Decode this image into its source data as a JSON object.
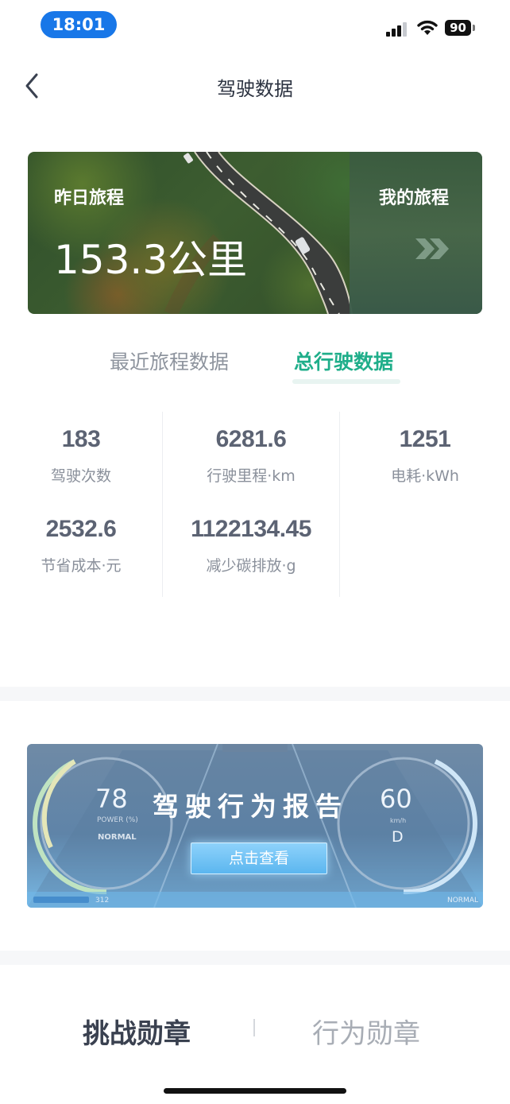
{
  "status_bar": {
    "time": "18:01",
    "battery": "90"
  },
  "nav": {
    "title": "驾驶数据"
  },
  "banner": {
    "yesterday_label": "昨日旅程",
    "yesterday_value": "153.3公里",
    "my_trip_label": "我的旅程"
  },
  "tabs": [
    {
      "label": "最近旅程数据",
      "active": false
    },
    {
      "label": "总行驶数据",
      "active": true
    }
  ],
  "stats": [
    {
      "value": "183",
      "label": "驾驶次数"
    },
    {
      "value": "6281.6",
      "label": "行驶里程·km"
    },
    {
      "value": "1251",
      "label": "电耗·kWh"
    },
    {
      "value": "2532.6",
      "label": "节省成本·元"
    },
    {
      "value": "1122134.45",
      "label": "减少碳排放·g"
    }
  ],
  "report": {
    "title": "驾驶行为报告",
    "left_value": "78",
    "left_unit": "POWER (%)",
    "left_mode": "NORMAL",
    "right_value": "60",
    "right_unit": "km/h",
    "gear": "D",
    "button_label": "点击查看",
    "odometer": "312",
    "right_mode": "NORMAL"
  },
  "bottom_tabs": [
    {
      "label": "挑战勋章",
      "active": true
    },
    {
      "label": "行为勋章",
      "active": false
    }
  ],
  "colors": {
    "accent": "#1fae8a",
    "time_pill": "#1877e8",
    "text_primary": "#3a4150",
    "text_secondary": "#8a909b"
  }
}
